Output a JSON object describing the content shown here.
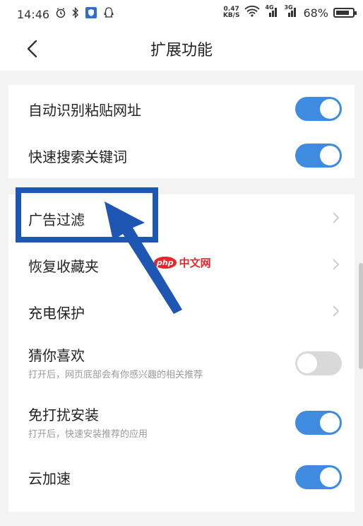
{
  "status_bar": {
    "time": "14:46",
    "net_speed_value": "0.47",
    "net_speed_unit": "KB/S",
    "signal1_label": "4G",
    "signal2_label": "3G",
    "battery": "68%",
    "icons": [
      "alarm-icon",
      "bluetooth-icon",
      "shield-app-icon",
      "qq-icon",
      "wifi-icon",
      "signal-icon",
      "battery-icon"
    ]
  },
  "header": {
    "title": "扩展功能"
  },
  "section1": {
    "rows": [
      {
        "label": "自动识别粘贴网址",
        "toggle": true
      },
      {
        "label": "快速搜索关键词",
        "toggle": true
      }
    ]
  },
  "section2": {
    "rows": [
      {
        "label": "广告过滤",
        "type": "link"
      },
      {
        "label": "恢复收藏夹",
        "type": "link"
      },
      {
        "label": "充电保护",
        "type": "link"
      },
      {
        "label": "猜你喜欢",
        "sublabel": "打开后，网页底部会有你感兴趣的相关推荐",
        "toggle": false
      },
      {
        "label": "免打扰安装",
        "sublabel": "打开后，快速安装推荐的应用",
        "toggle": true
      },
      {
        "label": "云加速",
        "toggle": true
      }
    ]
  },
  "watermark": {
    "badge": "php",
    "text": "中文网"
  },
  "colors": {
    "toggle_on": "#3f8be0",
    "toggle_off": "#d9d9d9",
    "annotation_blue": "#1e56b3",
    "page_bg": "#f3f3f3"
  }
}
